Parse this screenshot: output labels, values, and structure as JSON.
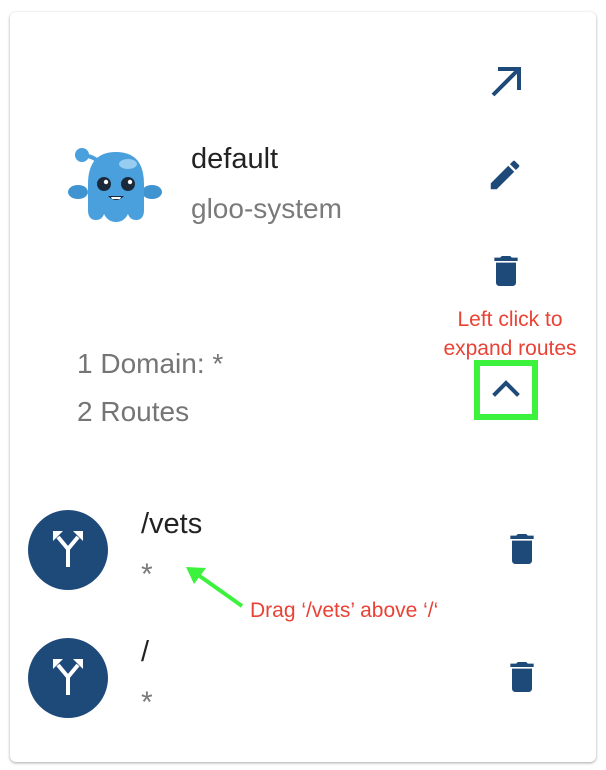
{
  "colors": {
    "accent": "#1e4a7a",
    "annotation_red": "#e94235",
    "annotation_green": "#3cf23c"
  },
  "virtual_service": {
    "name": "default",
    "namespace": "gloo-system",
    "domains_text": "1 Domain: *",
    "routes_text": "2 Routes",
    "logo_icon": "gloo-mascot-icon",
    "actions": {
      "open_icon": "arrow-up-right-icon",
      "edit_icon": "pencil-icon",
      "delete_icon": "trash-icon",
      "expand_icon": "chevron-up-icon"
    }
  },
  "routes": [
    {
      "path": "/vets",
      "matcher": "*",
      "icon": "route-split-icon"
    },
    {
      "path": "/",
      "matcher": "*",
      "icon": "route-split-icon"
    }
  ],
  "annotations": {
    "expand_hint_line1": "Left click to",
    "expand_hint_line2": "expand routes",
    "drag_hint": "Drag ‘/vets’ above ‘/‘"
  }
}
